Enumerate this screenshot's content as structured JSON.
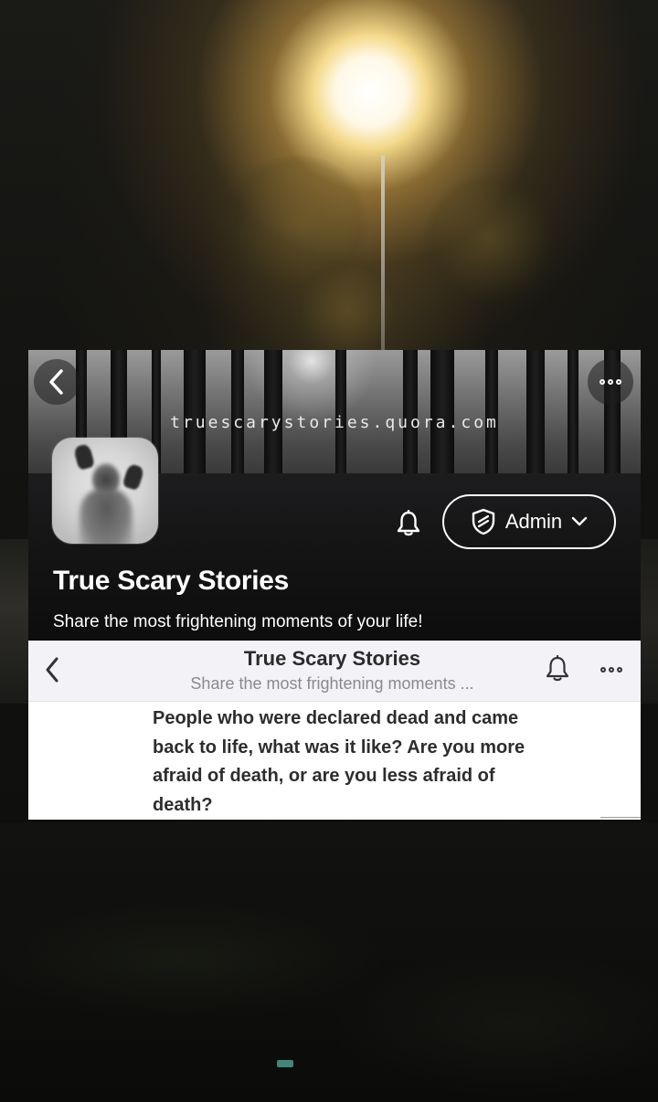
{
  "space_header": {
    "cover_url": "truescarystories.quora.com",
    "title": "True Scary Stories",
    "tagline": "Share the most frightening moments of your life!",
    "admin_label": "Admin"
  },
  "nav_bar": {
    "title": "True Scary Stories",
    "subtitle": "Share the most frightening moments ..."
  },
  "question": {
    "text": "People who were declared dead and came back to life, what was it like? Are you more afraid of death, or are you less afraid of death?"
  },
  "icons": {
    "back": "chevron-left-icon",
    "more": "more-dots-icon",
    "bell": "bell-icon",
    "shield": "shield-icon",
    "dropdown": "chevron-down-icon"
  },
  "colors": {
    "dark_card": "#151516",
    "light_nav": "#f2f2f7",
    "text_dark": "#2d2d2d",
    "text_muted": "#8a8a8e"
  }
}
